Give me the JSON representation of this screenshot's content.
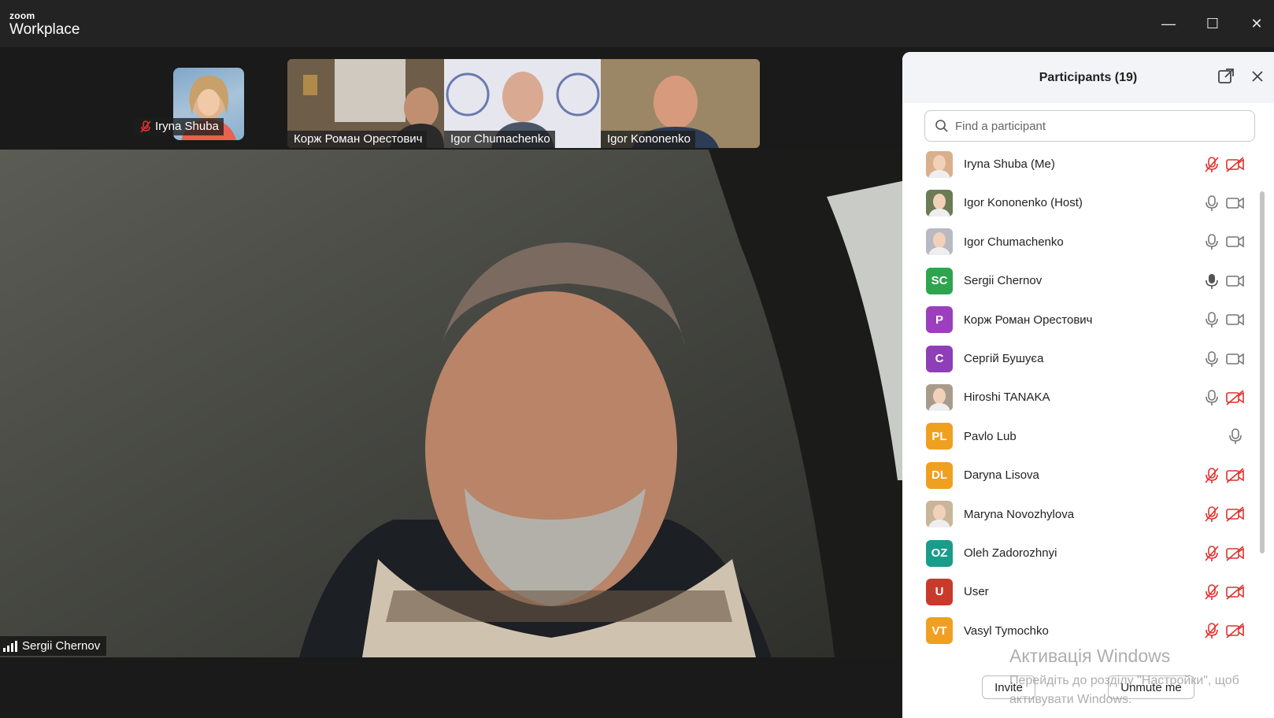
{
  "app": {
    "brand_small": "zoom",
    "brand_large": "Workplace"
  },
  "window_controls": {
    "minimize": "—",
    "maximize": "☐",
    "close": "✕"
  },
  "thumbnails": {
    "self": {
      "name": "Iryna Shuba"
    },
    "strip": [
      {
        "name": "Корж Роман Орестович"
      },
      {
        "name": "Igor Chumachenko"
      },
      {
        "name": "Igor Kononenko"
      }
    ]
  },
  "main_video": {
    "speaker": "Sergii Chernov"
  },
  "panel": {
    "title": "Participants (19)",
    "search_placeholder": "Find a participant",
    "participants": [
      {
        "name": "Iryna Shuba (Me)",
        "initials": "",
        "avatar_color": "#d9b08c",
        "photo": true,
        "mic": "muted",
        "cam": "off"
      },
      {
        "name": "Igor Kononenko (Host)",
        "initials": "",
        "avatar_color": "#6b7b55",
        "photo": true,
        "mic": "on",
        "cam": "on"
      },
      {
        "name": "Igor Chumachenko",
        "initials": "",
        "avatar_color": "#b9b9c4",
        "photo": true,
        "mic": "on",
        "cam": "on"
      },
      {
        "name": "Sergii Chernov",
        "initials": "SC",
        "avatar_color": "#2ea44f",
        "photo": false,
        "mic": "speaking",
        "cam": "on"
      },
      {
        "name": "Корж Роман Орестович",
        "initials": "P",
        "avatar_color": "#9b3fbf",
        "photo": false,
        "mic": "on",
        "cam": "on"
      },
      {
        "name": "Сергій Бушуєа",
        "initials": "C",
        "avatar_color": "#8e3fb8",
        "photo": false,
        "mic": "on",
        "cam": "on"
      },
      {
        "name": "Hiroshi TANAKA",
        "initials": "",
        "avatar_color": "#a89b8c",
        "photo": true,
        "mic": "on",
        "cam": "off"
      },
      {
        "name": "Pavlo Lub",
        "initials": "PL",
        "avatar_color": "#f0a020",
        "photo": false,
        "mic": "on",
        "cam": "none"
      },
      {
        "name": "Daryna Lisova",
        "initials": "DL",
        "avatar_color": "#f0a020",
        "photo": false,
        "mic": "muted",
        "cam": "off"
      },
      {
        "name": "Maryna Novozhylova",
        "initials": "",
        "avatar_color": "#c9b59a",
        "photo": true,
        "mic": "muted",
        "cam": "off"
      },
      {
        "name": "Oleh Zadorozhnyi",
        "initials": "OZ",
        "avatar_color": "#1a9c8a",
        "photo": false,
        "mic": "muted",
        "cam": "off"
      },
      {
        "name": "User",
        "initials": "U",
        "avatar_color": "#c93a2a",
        "photo": false,
        "mic": "muted",
        "cam": "off"
      },
      {
        "name": "Vasyl Tymochko",
        "initials": "VT",
        "avatar_color": "#f0a020",
        "photo": false,
        "mic": "muted",
        "cam": "off"
      }
    ],
    "invite_label": "Invite",
    "unmute_label": "Unmute me"
  },
  "watermark": {
    "line1": "Активація Windows",
    "line2": "Перейдіть до розділу \"Настройки\", щоб активувати Windows."
  },
  "colors": {
    "muted_red": "#e0312d",
    "icon_gray": "#777777"
  }
}
